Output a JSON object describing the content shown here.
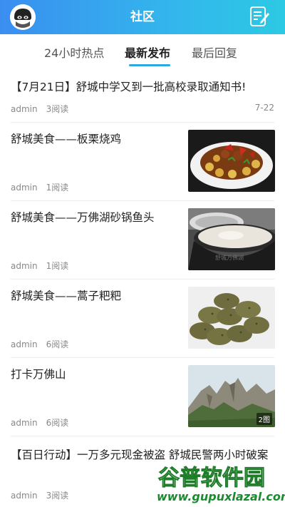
{
  "header": {
    "title": "社区",
    "avatar_icon": "ninja-avatar-icon",
    "edit_icon": "edit-note-icon"
  },
  "tabs": [
    {
      "label": "24小时热点",
      "active": false
    },
    {
      "label": "最新发布",
      "active": true
    },
    {
      "label": "最后回复",
      "active": false
    }
  ],
  "articles": [
    {
      "title": "【7月21日】舒城中学又到一批高校录取通知书!",
      "author": "admin",
      "reads": "3阅读",
      "date": "7-22"
    },
    {
      "title": "舒城美食——板栗烧鸡",
      "author": "admin",
      "reads": "1阅读"
    },
    {
      "title": "舒城美食——万佛湖砂锅鱼头",
      "author": "admin",
      "reads": "1阅读"
    },
    {
      "title": "舒城美食——蒿子粑粑",
      "author": "admin",
      "reads": "6阅读"
    },
    {
      "title": "打卡万佛山",
      "author": "admin",
      "reads": "6阅读",
      "badge": "2图"
    },
    {
      "title": "【百日行动】一万多元现金被盗 舒城民警两小时破案",
      "author": "admin",
      "reads": "3阅读"
    }
  ],
  "watermark": {
    "name": "谷普软件园",
    "url": "www.gupuxlazal.com"
  },
  "colors": {
    "header_start": "#3a8ef0",
    "header_end": "#2cc9e4",
    "tab_indicator": "#2ea7e6",
    "meta_text": "#888888"
  }
}
